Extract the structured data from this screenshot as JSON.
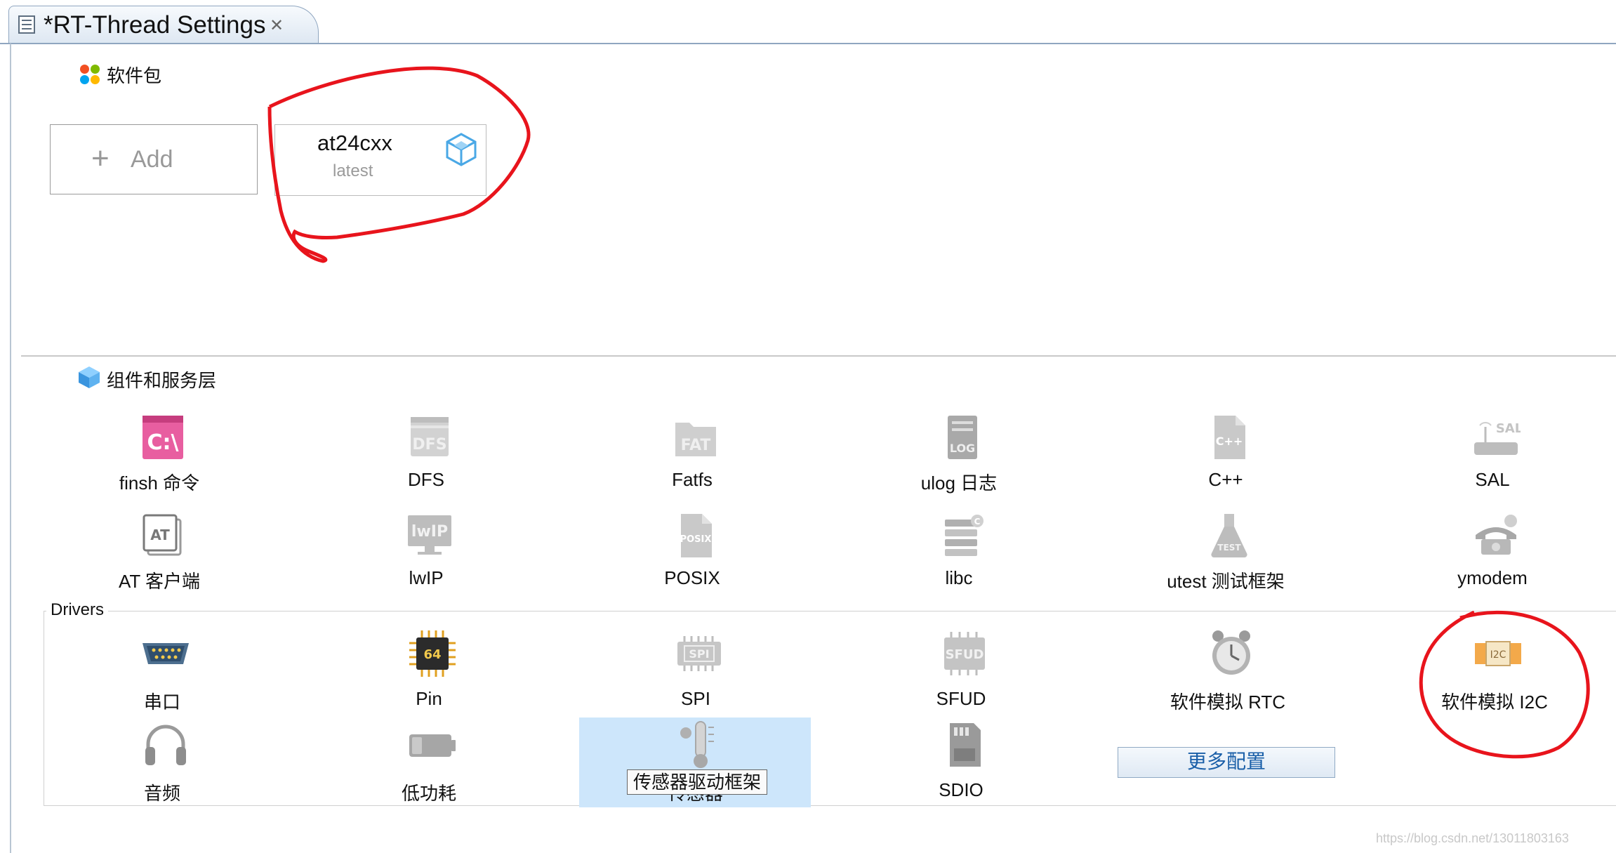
{
  "tab": {
    "title": "*RT-Thread Settings",
    "close_glyph": "✕",
    "icon": "settings-page-icon"
  },
  "packages": {
    "title": "软件包",
    "icon": "packages-icon",
    "add_label": "Add",
    "items": [
      {
        "name": "at24cxx",
        "version": "latest",
        "icon": "package-cube-icon"
      }
    ]
  },
  "components": {
    "title": "组件和服务层",
    "icon": "components-cube-icon",
    "items": [
      {
        "label": "finsh 命令",
        "icon": "console-icon",
        "enabled": true
      },
      {
        "label": "DFS",
        "icon": "dfs-folder-icon",
        "enabled": false
      },
      {
        "label": "Fatfs",
        "icon": "fat-folder-icon",
        "enabled": false
      },
      {
        "label": "ulog 日志",
        "icon": "log-icon",
        "enabled": false
      },
      {
        "label": "C++",
        "icon": "cpp-file-icon",
        "enabled": false
      },
      {
        "label": "SAL",
        "icon": "sal-router-icon",
        "enabled": false
      },
      {
        "label": "AT 客户端",
        "icon": "at-client-icon",
        "enabled": false
      },
      {
        "label": "lwIP",
        "icon": "lwip-monitor-icon",
        "enabled": false
      },
      {
        "label": "POSIX",
        "icon": "posix-file-icon",
        "enabled": false
      },
      {
        "label": "libc",
        "icon": "libc-books-icon",
        "enabled": false
      },
      {
        "label": "utest 测试框架",
        "icon": "test-flask-icon",
        "enabled": false
      },
      {
        "label": "ymodem",
        "icon": "ymodem-phone-icon",
        "enabled": false
      }
    ]
  },
  "drivers": {
    "title": "Drivers",
    "items": [
      {
        "label": "串口",
        "icon": "serial-port-icon",
        "enabled": true
      },
      {
        "label": "Pin",
        "icon": "pin-chip-icon",
        "enabled": true
      },
      {
        "label": "SPI",
        "icon": "spi-chip-icon",
        "enabled": false
      },
      {
        "label": "SFUD",
        "icon": "sfud-chip-icon",
        "enabled": false
      },
      {
        "label": "软件模拟 RTC",
        "icon": "rtc-clock-icon",
        "enabled": false
      },
      {
        "label": "软件模拟 I2C",
        "icon": "i2c-chip-icon",
        "enabled": true
      },
      {
        "label": "音频",
        "icon": "headphones-icon",
        "enabled": false
      },
      {
        "label": "低功耗",
        "icon": "battery-icon",
        "enabled": false
      },
      {
        "label": "传感器",
        "icon": "thermometer-icon",
        "enabled": false,
        "selected": true
      },
      {
        "label": "SDIO",
        "icon": "sd-card-icon",
        "enabled": false
      }
    ],
    "tooltip": "传感器驱动框架",
    "more_label": "更多配置"
  },
  "watermark": "https://blog.csdn.net/13011803163",
  "colors": {
    "annotation": "#e8141c",
    "selection": "#cde6fb",
    "link": "#1a5fa8"
  }
}
